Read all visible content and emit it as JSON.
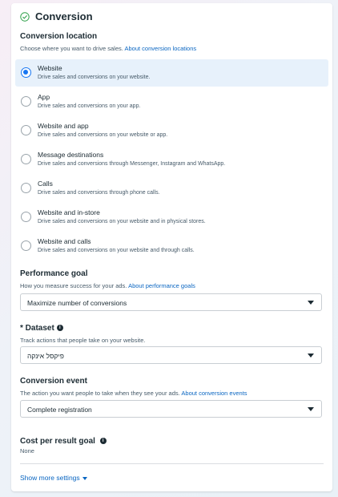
{
  "section": {
    "title": "Conversion"
  },
  "conversion_location": {
    "title": "Conversion location",
    "subtitle": "Choose where you want to drive sales.",
    "link": "About conversion locations",
    "options": [
      {
        "label": "Website",
        "desc": "Drive sales and conversions on your website.",
        "selected": true
      },
      {
        "label": "App",
        "desc": "Drive sales and conversions on your app.",
        "selected": false
      },
      {
        "label": "Website and app",
        "desc": "Drive sales and conversions on your website or app.",
        "selected": false
      },
      {
        "label": "Message destinations",
        "desc": "Drive sales and conversions through Messenger, Instagram and WhatsApp.",
        "selected": false
      },
      {
        "label": "Calls",
        "desc": "Drive sales and conversions through phone calls.",
        "selected": false
      },
      {
        "label": "Website and in-store",
        "desc": "Drive sales and conversions on your website and in physical stores.",
        "selected": false
      },
      {
        "label": "Website and calls",
        "desc": "Drive sales and conversions on your website and through calls.",
        "selected": false
      }
    ]
  },
  "performance_goal": {
    "title": "Performance goal",
    "subtitle": "How you measure success for your ads.",
    "link": "About performance goals",
    "value": "Maximize number of conversions"
  },
  "dataset": {
    "title": "* Dataset",
    "subtitle": "Track actions that people take on your website.",
    "value": "פיקסל אינקה"
  },
  "conversion_event": {
    "title": "Conversion event",
    "subtitle": "The action you want people to take when they see your ads.",
    "link": "About conversion events",
    "value": "Complete registration"
  },
  "cost_goal": {
    "title": "Cost per result goal",
    "value": "None"
  },
  "show_more": {
    "label": "Show more settings"
  },
  "colors": {
    "accent": "#1877f2",
    "link": "#0a66c2",
    "selected_bg": "#e7f1fb",
    "check": "#31a24c"
  }
}
